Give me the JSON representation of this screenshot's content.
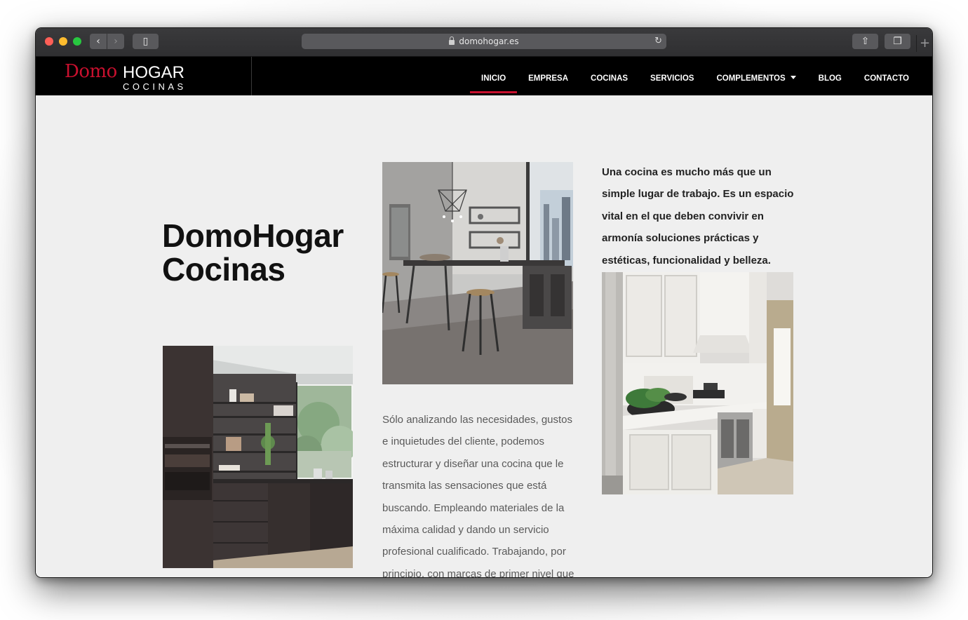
{
  "browser": {
    "url": "domohogar.es",
    "back_icon": "‹",
    "forward_icon": "›",
    "sidebar_icon": "▯",
    "share_icon": "⇧",
    "tabs_icon": "❐",
    "reload_icon": "↻",
    "new_tab_icon": "+"
  },
  "logo": {
    "domo": "Domo",
    "hogar": "HOGAR",
    "cocinas": "COCINAS"
  },
  "nav": {
    "items": [
      {
        "label": "INICIO",
        "active": true
      },
      {
        "label": "EMPRESA"
      },
      {
        "label": "COCINAS"
      },
      {
        "label": "SERVICIOS"
      },
      {
        "label": "COMPLEMENTOS",
        "has_dropdown": true
      },
      {
        "label": "BLOG"
      },
      {
        "label": "CONTACTO"
      }
    ]
  },
  "hero": {
    "title_line1": "DomoHogar",
    "title_line2": "Cocinas"
  },
  "content": {
    "lead": "Una cocina es mucho más que un simple lugar de trabajo. Es un espacio vital en el que deben convivir en armonía soluciones prácticas y estéticas, funcionalidad y belleza.",
    "body": "Sólo analizando las necesidades, gustos e inquietudes del cliente, podemos estructurar y diseñar una cocina que le transmita las sensaciones que está buscando. Empleando materiales de la máxima calidad y dando un servicio profesional cualificado. Trabajando, por principio, con marcas de primer nivel que"
  },
  "colors": {
    "brand_red": "#c8102e",
    "nav_bg": "#000000",
    "page_bg": "#efefef"
  }
}
